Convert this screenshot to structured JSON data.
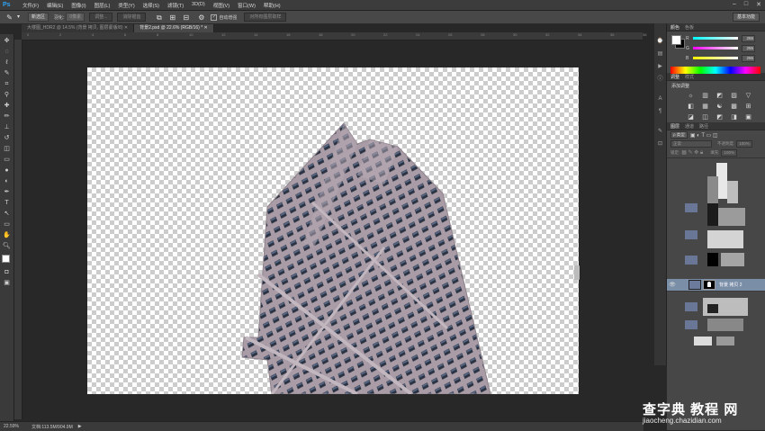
{
  "app": {
    "logo": "Ps"
  },
  "menu": [
    "文件(F)",
    "编辑(E)",
    "图像(I)",
    "图层(L)",
    "类型(Y)",
    "选择(S)",
    "滤镜(T)",
    "3D(D)",
    "视图(V)",
    "窗口(W)",
    "帮助(H)"
  ],
  "window_controls": [
    "–",
    "□",
    "✕"
  ],
  "options_bar": {
    "mode_value": "新选区",
    "feather_label": "羽化:",
    "feather_value": "0像素",
    "anti_alias_label": "消除锯齿",
    "width_field": "调整边缘...",
    "refine_edge_label": "调整...",
    "auto_enhance_label": "自动增强",
    "auto_enhance_checked": "✓",
    "sample_all_label": "对所有图层取样",
    "workspace": "基本功能"
  },
  "doc_tabs": [
    {
      "label": "大楼图_HDR2 @ 14.5% (背景 拷贝, 图层蒙版/8) ✕"
    },
    {
      "label": "背景2.psd @ 22.6% (RGB/16) * ✕"
    }
  ],
  "ruler_marks": [
    "0",
    "2",
    "4",
    "6",
    "8",
    "10",
    "12",
    "14",
    "16",
    "18",
    "20",
    "22",
    "24",
    "26",
    "28",
    "30",
    "32",
    "34",
    "36",
    "38"
  ],
  "status": {
    "zoom": "22.59%",
    "doc_info": "文档:113.5M/904.9M",
    "arrow": "▶"
  },
  "color_panel": {
    "tabs": [
      "颜色",
      "色板"
    ],
    "channels": [
      {
        "ch": "R",
        "value": "255",
        "gradient": "linear-gradient(90deg,#00ffff,#ffffff)"
      },
      {
        "ch": "G",
        "value": "255",
        "gradient": "linear-gradient(90deg,#ff00ff,#ffffff)"
      },
      {
        "ch": "B",
        "value": "255",
        "gradient": "linear-gradient(90deg,#ffff00,#ffffff)"
      }
    ],
    "foreground": "#ffffff",
    "background": "#000000"
  },
  "adjust_panel": {
    "tabs": [
      "调整",
      "样式"
    ],
    "title": "添加调整",
    "icons": [
      "☼",
      "▥",
      "◩",
      "▨",
      "▽",
      "◧",
      "▦",
      "☯",
      "▩",
      "⊞",
      "◪",
      "◫",
      "◩",
      "◨",
      "▣"
    ]
  },
  "layers_panel": {
    "tabs": [
      "图层",
      "通道",
      "路径"
    ],
    "kind_label": "ρ 类型",
    "blend": "正常",
    "opacity_label": "不透明度:",
    "opacity_value": "100%",
    "lock_label": "锁定:",
    "fill_label": "填充:",
    "fill_value": "100%",
    "selected_layer": "背景 拷贝 2",
    "eye_icon": "👁"
  },
  "watermark": {
    "text": "查字典 教程 网",
    "url": "jiaocheng.chazidian.com"
  }
}
